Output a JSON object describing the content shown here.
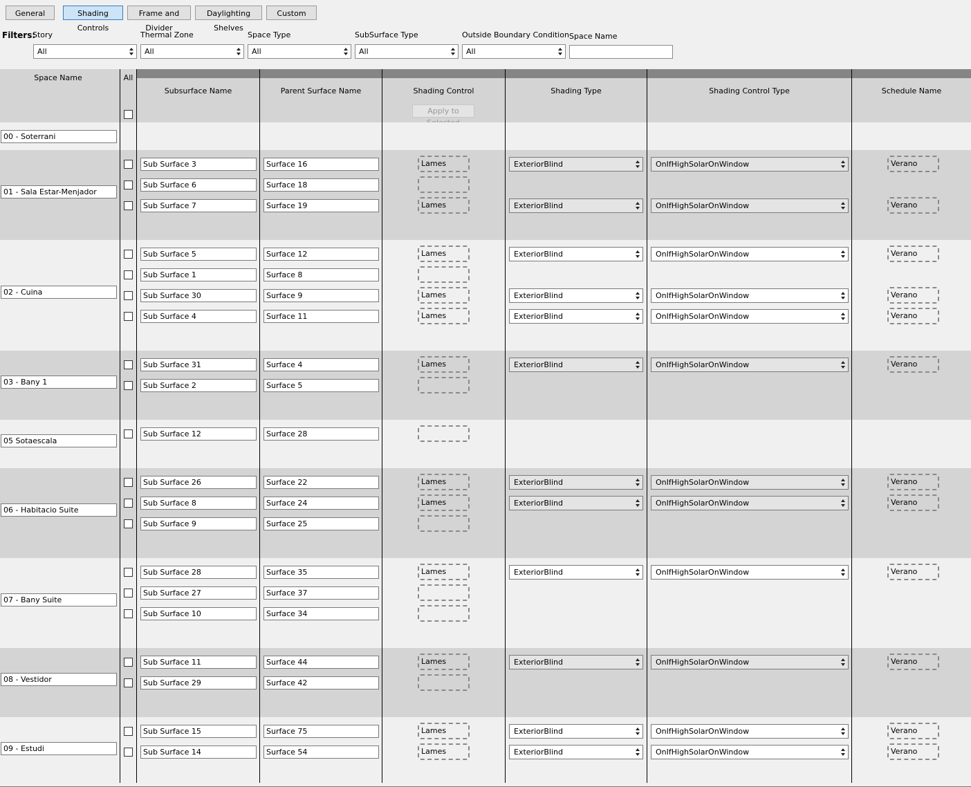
{
  "tabs": [
    {
      "label": "General"
    },
    {
      "label": "Shading Controls"
    },
    {
      "label": "Frame and Divider"
    },
    {
      "label": "Daylighting Shelves"
    },
    {
      "label": "Custom"
    }
  ],
  "active_tab": "Shading Controls",
  "filters": {
    "label": "Filters:",
    "story": {
      "label": "Story",
      "value": "All"
    },
    "thermal_zone": {
      "label": "Thermal Zone",
      "value": "All"
    },
    "space_type": {
      "label": "Space Type",
      "value": "All"
    },
    "subsurface_type": {
      "label": "SubSurface Type",
      "value": "All"
    },
    "outside_boundary": {
      "label": "Outside Boundary Condition",
      "value": "All"
    },
    "space_name": {
      "label": "Space Name",
      "value": ""
    }
  },
  "columns": {
    "space_name": "Space Name",
    "all": "All",
    "subsurface_name": "Subsurface Name",
    "parent_surface_name": "Parent Surface Name",
    "shading_control": "Shading Control",
    "apply_to_selected": "Apply to Selected",
    "shading_type": "Shading Type",
    "shading_control_type": "Shading Control Type",
    "schedule_name": "Schedule Name"
  },
  "spaces": [
    {
      "name": "00 - Soterrani",
      "subsurfaces": []
    },
    {
      "name": "01 - Sala Estar-Menjador",
      "subsurfaces": [
        {
          "name": "Sub Surface 3",
          "parent": "Surface 16",
          "control": "Lames",
          "shading_type": "ExteriorBlind",
          "control_type": "OnIfHighSolarOnWindow",
          "schedule": "Verano"
        },
        {
          "name": "Sub Surface 6",
          "parent": "Surface 18",
          "control": "",
          "shading_type": "",
          "control_type": "",
          "schedule": ""
        },
        {
          "name": "Sub Surface 7",
          "parent": "Surface 19",
          "control": "Lames",
          "shading_type": "ExteriorBlind",
          "control_type": "OnIfHighSolarOnWindow",
          "schedule": "Verano"
        }
      ]
    },
    {
      "name": "02 - Cuina",
      "subsurfaces": [
        {
          "name": "Sub Surface 5",
          "parent": "Surface 12",
          "control": "Lames",
          "shading_type": "ExteriorBlind",
          "control_type": "OnIfHighSolarOnWindow",
          "schedule": "Verano"
        },
        {
          "name": "Sub Surface 1",
          "parent": "Surface 8",
          "control": "",
          "shading_type": "",
          "control_type": "",
          "schedule": ""
        },
        {
          "name": "Sub Surface 30",
          "parent": "Surface 9",
          "control": "Lames",
          "shading_type": "ExteriorBlind",
          "control_type": "OnIfHighSolarOnWindow",
          "schedule": "Verano"
        },
        {
          "name": "Sub Surface 4",
          "parent": "Surface 11",
          "control": "Lames",
          "shading_type": "ExteriorBlind",
          "control_type": "OnIfHighSolarOnWindow",
          "schedule": "Verano"
        }
      ]
    },
    {
      "name": "03 - Bany 1",
      "subsurfaces": [
        {
          "name": "Sub Surface 31",
          "parent": "Surface 4",
          "control": "Lames",
          "shading_type": "ExteriorBlind",
          "control_type": "OnIfHighSolarOnWindow",
          "schedule": "Verano"
        },
        {
          "name": "Sub Surface 2",
          "parent": "Surface 5",
          "control": "",
          "shading_type": "",
          "control_type": "",
          "schedule": ""
        }
      ]
    },
    {
      "name": "05 Sotaescala",
      "subsurfaces": [
        {
          "name": "Sub Surface 12",
          "parent": "Surface 28",
          "control": "",
          "shading_type": "",
          "control_type": "",
          "schedule": ""
        }
      ]
    },
    {
      "name": "06 - Habitacio Suite",
      "subsurfaces": [
        {
          "name": "Sub Surface 26",
          "parent": "Surface 22",
          "control": "Lames",
          "shading_type": "ExteriorBlind",
          "control_type": "OnIfHighSolarOnWindow",
          "schedule": "Verano"
        },
        {
          "name": "Sub Surface 8",
          "parent": "Surface 24",
          "control": "Lames",
          "shading_type": "ExteriorBlind",
          "control_type": "OnIfHighSolarOnWindow",
          "schedule": "Verano"
        },
        {
          "name": "Sub Surface 9",
          "parent": "Surface 25",
          "control": "",
          "shading_type": "",
          "control_type": "",
          "schedule": ""
        }
      ]
    },
    {
      "name": "07 - Bany Suite",
      "subsurfaces": [
        {
          "name": "Sub Surface 28",
          "parent": "Surface 35",
          "control": "Lames",
          "shading_type": "ExteriorBlind",
          "control_type": "OnIfHighSolarOnWindow",
          "schedule": "Verano"
        },
        {
          "name": "Sub Surface 27",
          "parent": "Surface 37",
          "control": "",
          "shading_type": "",
          "control_type": "",
          "schedule": ""
        },
        {
          "name": "Sub Surface 10",
          "parent": "Surface 34",
          "control": "",
          "shading_type": "",
          "control_type": "",
          "schedule": ""
        }
      ]
    },
    {
      "name": "08 - Vestidor",
      "subsurfaces": [
        {
          "name": "Sub Surface 11",
          "parent": "Surface 44",
          "control": "Lames",
          "shading_type": "ExteriorBlind",
          "control_type": "OnIfHighSolarOnWindow",
          "schedule": "Verano"
        },
        {
          "name": "Sub Surface 29",
          "parent": "Surface 42",
          "control": "",
          "shading_type": "",
          "control_type": "",
          "schedule": ""
        }
      ]
    },
    {
      "name": "09 - Estudi",
      "subsurfaces": [
        {
          "name": "Sub Surface 15",
          "parent": "Surface 75",
          "control": "Lames",
          "shading_type": "ExteriorBlind",
          "control_type": "OnIfHighSolarOnWindow",
          "schedule": "Verano"
        },
        {
          "name": "Sub Surface 14",
          "parent": "Surface 54",
          "control": "Lames",
          "shading_type": "ExteriorBlind",
          "control_type": "OnIfHighSolarOnWindow",
          "schedule": "Verano"
        }
      ]
    }
  ]
}
